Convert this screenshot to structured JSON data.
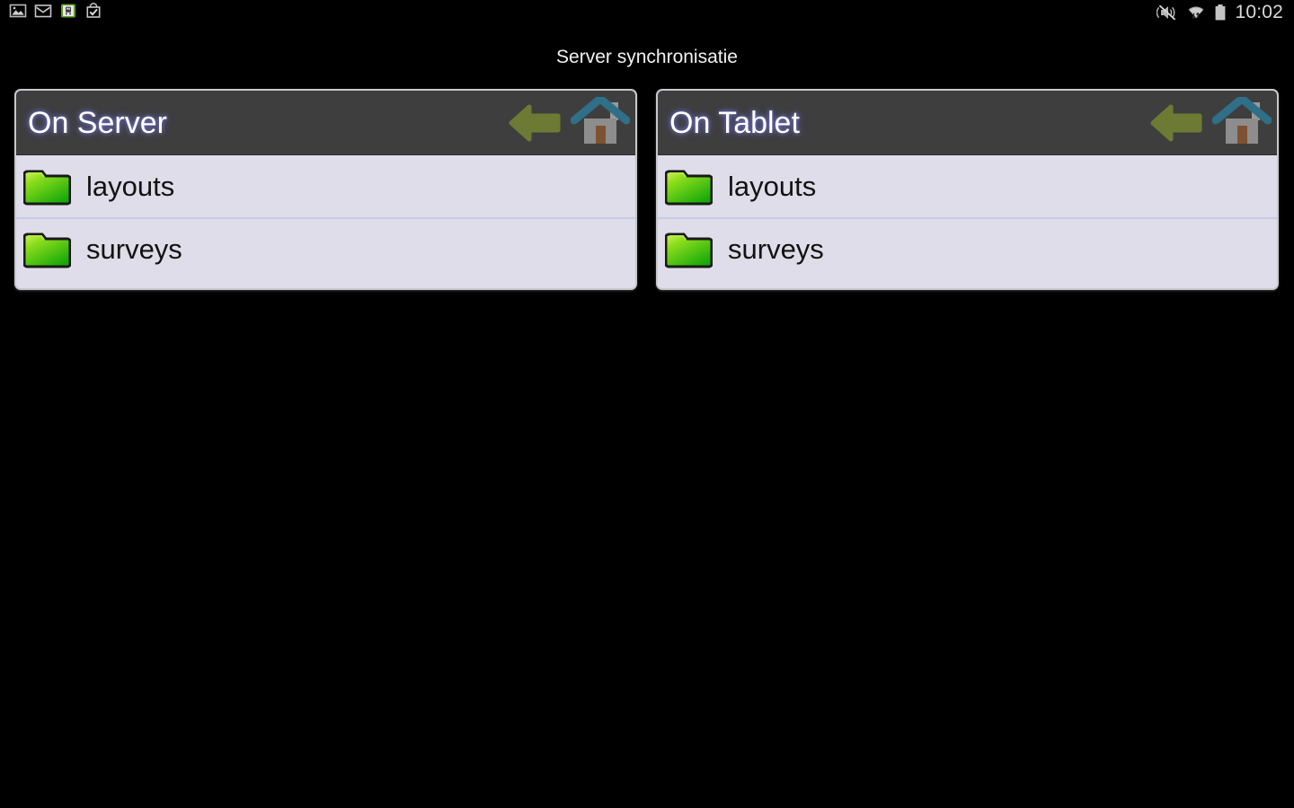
{
  "status_bar": {
    "time": "10:02",
    "left_icons": [
      {
        "name": "gallery-image-icon",
        "label": "Screenshot captured"
      },
      {
        "name": "gmail-icon",
        "label": "Gmail"
      },
      {
        "name": "transit-app-icon",
        "label": "Transit"
      },
      {
        "name": "play-store-bag-check-icon",
        "label": "App installed"
      }
    ],
    "right_icons": [
      {
        "name": "volume-muted-icon",
        "label": "Silent mode"
      },
      {
        "name": "wifi-transfer-icon",
        "label": "Wi-Fi connected"
      },
      {
        "name": "battery-full-icon",
        "label": "Battery full"
      }
    ]
  },
  "header": {
    "title": "Server synchronisatie"
  },
  "panels": [
    {
      "id": "server",
      "title": "On Server",
      "back_label": "Back",
      "home_label": "Home",
      "items": [
        {
          "name": "layouts",
          "type": "folder"
        },
        {
          "name": "surveys",
          "type": "folder"
        }
      ]
    },
    {
      "id": "tablet",
      "title": "On Tablet",
      "back_label": "Back",
      "home_label": "Home",
      "items": [
        {
          "name": "layouts",
          "type": "folder"
        },
        {
          "name": "surveys",
          "type": "folder"
        }
      ]
    }
  ],
  "colors": {
    "background": "#000000",
    "panel_background": "#dedde9",
    "panel_header": "#3e3e3e",
    "panel_border": "#c8c8cc",
    "divider": "#c9c9e8",
    "title_text": "#f2f2f2",
    "folder_green": "#4fc40c",
    "back_arrow_olive": "#6d7a34",
    "home_roof_teal": "#2f6f87",
    "home_body_gray": "#8d8d8d",
    "home_door_brown": "#7d5232"
  }
}
